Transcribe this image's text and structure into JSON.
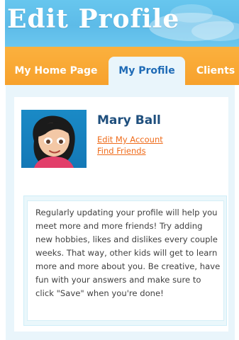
{
  "header": {
    "title": "Edit Profile"
  },
  "tabs": [
    {
      "label": "My Home Page"
    },
    {
      "label": "My Profile"
    },
    {
      "label": "Clients"
    }
  ],
  "profile": {
    "name": "Mary Ball",
    "links": {
      "edit_account": "Edit My Account",
      "find_friends": "Find Friends"
    }
  },
  "tip": {
    "text": "Regularly updating your profile will help you meet more and more friends! Try adding new hobbies, likes and dislikes every couple weeks. That way, other kids will get to learn more and more about you. Be creative, have fun with your answers and make sure to click \"Save\" when you're done!"
  },
  "colors": {
    "header_sky": "#5dbbe8",
    "tabbar_orange": "#f7a12c",
    "active_tab_text": "#1f6bb6",
    "name_text": "#1f4f7d",
    "link_orange": "#ef6b1a"
  }
}
